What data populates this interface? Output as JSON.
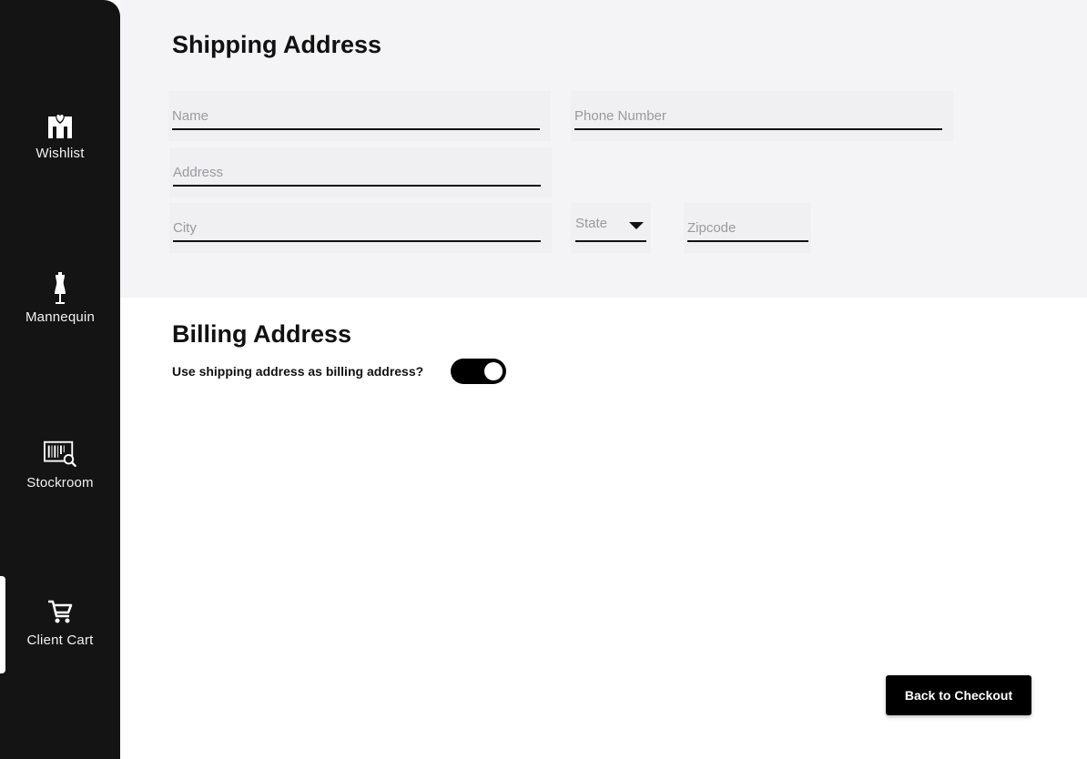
{
  "sidebar": {
    "items": [
      {
        "label": "Wishlist",
        "icon": "wishlist-icon"
      },
      {
        "label": "Mannequin",
        "icon": "mannequin-icon"
      },
      {
        "label": "Stockroom",
        "icon": "stockroom-icon"
      },
      {
        "label": "Client Cart",
        "icon": "cart-icon",
        "active": true
      }
    ]
  },
  "shipping": {
    "title": "Shipping Address",
    "name_placeholder": "Name",
    "phone_placeholder": "Phone Number",
    "address_placeholder": "Address",
    "city_placeholder": "City",
    "state_placeholder": "State",
    "zip_placeholder": "Zipcode"
  },
  "billing": {
    "title": "Billing Address",
    "toggle_label": "Use shipping address as billing address?",
    "toggle_on": true
  },
  "actions": {
    "back_label": "Back to Checkout"
  },
  "colors": {
    "sidebar_bg": "#141414",
    "shipping_bg": "#f4f4f6",
    "accent": "#000000"
  }
}
